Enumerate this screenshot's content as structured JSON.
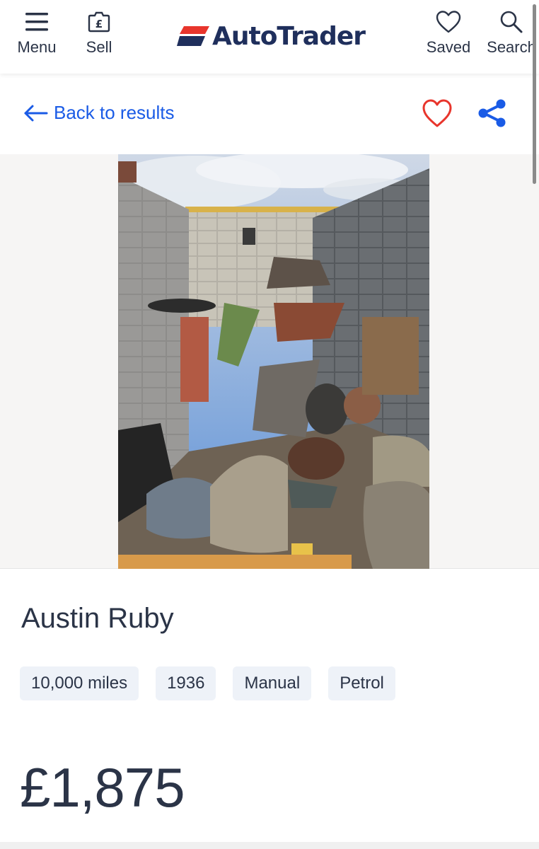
{
  "header": {
    "menu_label": "Menu",
    "sell_label": "Sell",
    "logo_text": "AutoTrader",
    "saved_label": "Saved",
    "search_label": "Search"
  },
  "nav": {
    "back_label": "Back to results"
  },
  "listing": {
    "title": "Austin Ruby",
    "specs": [
      "10,000 miles",
      "1936",
      "Manual",
      "Petrol"
    ],
    "price": "£1,875"
  },
  "colors": {
    "brand_navy": "#1f2f5c",
    "brand_red": "#e8352c",
    "link_blue": "#1a5be6",
    "heart_red": "#e8352c",
    "chip_bg": "#eef2f8"
  },
  "icons": {
    "menu": "hamburger-icon",
    "sell": "pound-tag-icon",
    "saved": "heart-outline-icon",
    "search": "magnifier-icon",
    "back": "arrow-left-icon",
    "favourite": "heart-outline-icon",
    "share": "share-icon"
  }
}
